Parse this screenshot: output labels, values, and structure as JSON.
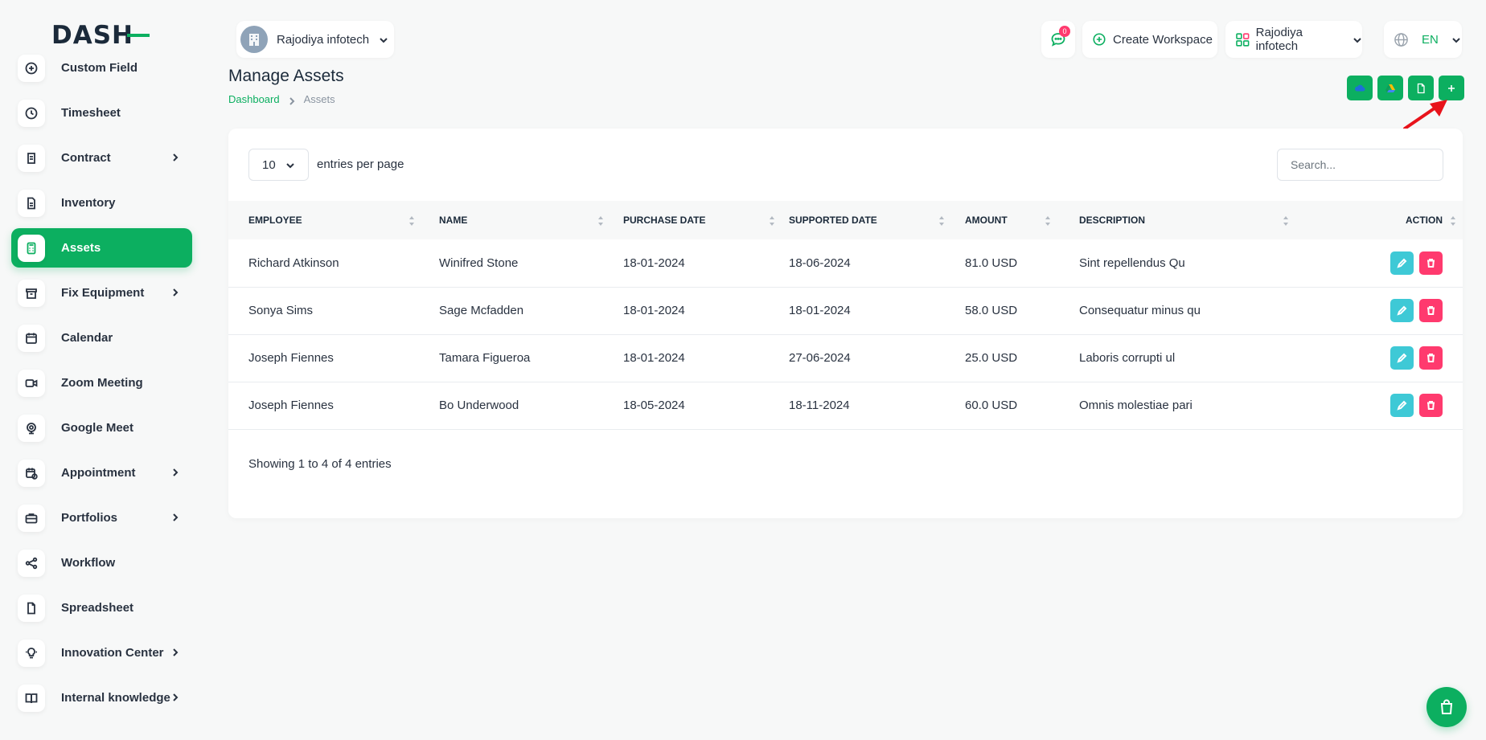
{
  "brand": {
    "logo_text": "DASH",
    "accent": "#0caf60"
  },
  "sidebar": {
    "items": [
      {
        "label": "Custom Field",
        "icon": "plus-circle-icon",
        "has_chevron": false,
        "active": false
      },
      {
        "label": "Timesheet",
        "icon": "clock-icon",
        "has_chevron": false,
        "active": false
      },
      {
        "label": "Contract",
        "icon": "contract-icon",
        "has_chevron": true,
        "active": false
      },
      {
        "label": "Inventory",
        "icon": "document-icon",
        "has_chevron": false,
        "active": false
      },
      {
        "label": "Assets",
        "icon": "calculator-icon",
        "has_chevron": false,
        "active": true
      },
      {
        "label": "Fix Equipment",
        "icon": "archive-icon",
        "has_chevron": true,
        "active": false
      },
      {
        "label": "Calendar",
        "icon": "calendar-icon",
        "has_chevron": false,
        "active": false
      },
      {
        "label": "Zoom Meeting",
        "icon": "video-icon",
        "has_chevron": false,
        "active": false
      },
      {
        "label": "Google Meet",
        "icon": "webcam-icon",
        "has_chevron": false,
        "active": false
      },
      {
        "label": "Appointment",
        "icon": "calendar-clock-icon",
        "has_chevron": true,
        "active": false
      },
      {
        "label": "Portfolios",
        "icon": "briefcase-icon",
        "has_chevron": true,
        "active": false
      },
      {
        "label": "Workflow",
        "icon": "share-icon",
        "has_chevron": false,
        "active": false
      },
      {
        "label": "Spreadsheet",
        "icon": "file-icon",
        "has_chevron": false,
        "active": false
      },
      {
        "label": "Innovation Center",
        "icon": "bulb-icon",
        "has_chevron": true,
        "active": false
      },
      {
        "label": "Internal knowledge",
        "icon": "book-icon",
        "has_chevron": true,
        "active": false
      }
    ]
  },
  "header": {
    "workspace_name": "Rajodiya infotech",
    "chat_badge": "0",
    "create_workspace_label": "Create Workspace",
    "company_name": "Rajodiya infotech",
    "language": "EN"
  },
  "page": {
    "title": "Manage Assets",
    "breadcrumb": {
      "home": "Dashboard",
      "current": "Assets"
    }
  },
  "table": {
    "per_page_value": "10",
    "per_page_label": "entries per page",
    "search_placeholder": "Search...",
    "columns": [
      "EMPLOYEE",
      "NAME",
      "PURCHASE DATE",
      "SUPPORTED DATE",
      "AMOUNT",
      "DESCRIPTION",
      "ACTION"
    ],
    "rows": [
      {
        "employee": "Richard Atkinson",
        "name": "Winifred Stone",
        "purchase_date": "18-01-2024",
        "supported_date": "18-06-2024",
        "amount": "81.0 USD",
        "description": "Sint repellendus Qu"
      },
      {
        "employee": "Sonya Sims",
        "name": "Sage Mcfadden",
        "purchase_date": "18-01-2024",
        "supported_date": "18-01-2024",
        "amount": "58.0 USD",
        "description": "Consequatur minus qu"
      },
      {
        "employee": "Joseph Fiennes",
        "name": "Tamara Figueroa",
        "purchase_date": "18-01-2024",
        "supported_date": "27-06-2024",
        "amount": "25.0 USD",
        "description": "Laboris corrupti ul"
      },
      {
        "employee": "Joseph Fiennes",
        "name": "Bo Underwood",
        "purchase_date": "18-05-2024",
        "supported_date": "18-11-2024",
        "amount": "60.0 USD",
        "description": "Omnis molestiae pari"
      }
    ],
    "footer": "Showing 1 to 4 of 4 entries"
  }
}
